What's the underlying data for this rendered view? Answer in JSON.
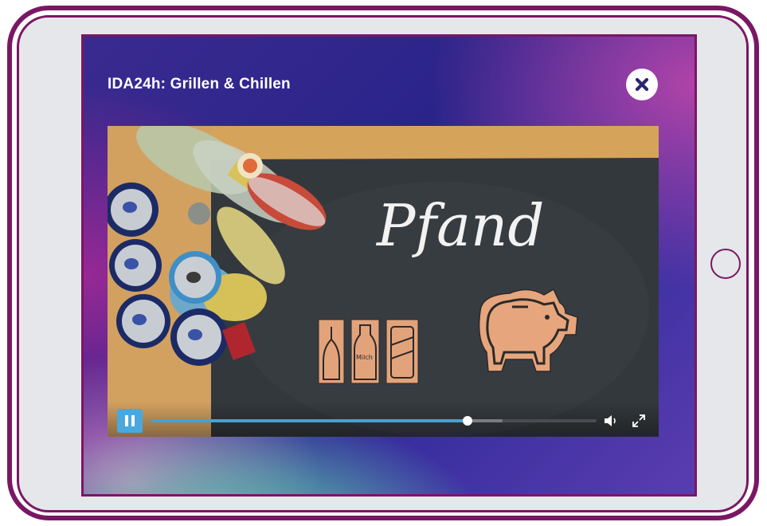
{
  "video_modal": {
    "title": "IDA24h: Grillen & Chillen",
    "close_icon": "close-icon"
  },
  "video_frame": {
    "chalkboard_text": "Pfand",
    "bottle_label": "Milch"
  },
  "player": {
    "state": "playing",
    "pause_icon": "pause-icon",
    "progress_fraction": 0.711,
    "buffered_fraction": 0.79,
    "volume_icon": "volume-icon",
    "fullscreen_icon": "fullscreen-icon"
  },
  "colors": {
    "tablet_frame": "#7a1764",
    "player_accent": "#3fa2dc",
    "modal_background": "#2a248a"
  }
}
